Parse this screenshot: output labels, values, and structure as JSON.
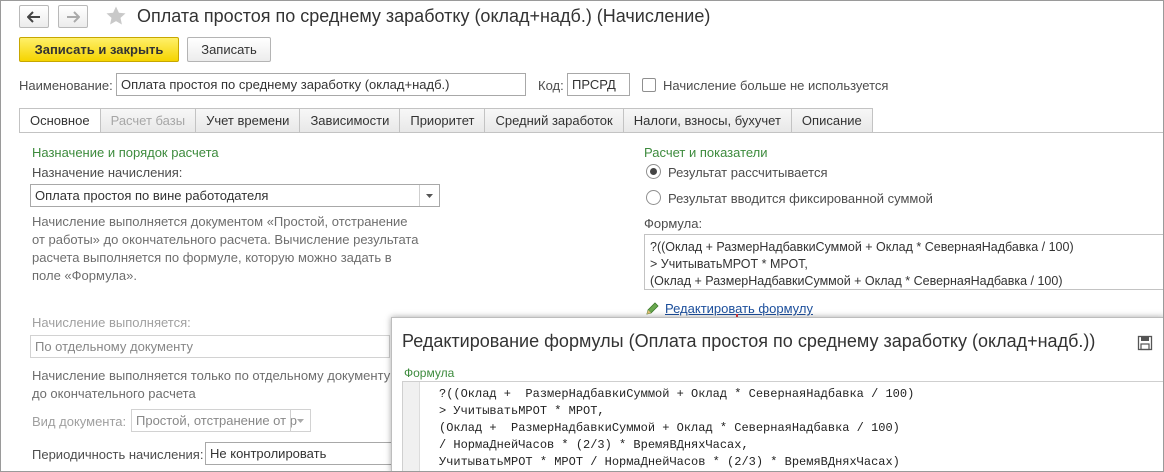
{
  "window": {
    "title": "Оплата простоя по среднему заработку (оклад+надб.) (Начисление)"
  },
  "toolbar": {
    "save_close_label": "Записать и закрыть",
    "save_label": "Записать"
  },
  "header": {
    "name_label": "Наименование:",
    "name_value": "Оплата простоя по среднему заработку (оклад+надб.)",
    "code_label": "Код:",
    "code_value": "ПРСРД",
    "unused_label": "Начисление больше не используется"
  },
  "tabs": [
    {
      "label": "Основное"
    },
    {
      "label": "Расчет базы"
    },
    {
      "label": "Учет времени"
    },
    {
      "label": "Зависимости"
    },
    {
      "label": "Приоритет"
    },
    {
      "label": "Средний заработок"
    },
    {
      "label": "Налоги, взносы, бухучет"
    },
    {
      "label": "Описание"
    }
  ],
  "left": {
    "section_title": "Назначение и порядок расчета",
    "purpose_label": "Назначение начисления:",
    "purpose_value": "Оплата простоя по вине работодателя",
    "description": "Начисление выполняется документом «Простой, отстранение от работы» до окончательного расчета. Вычисление результата расчета выполняется по формуле, которую можно задать в поле «Формула».",
    "executed_label": "Начисление выполняется:",
    "executed_value": "По отдельному документу",
    "separate_doc_text": "Начисление выполняется только по отдельному документу до окончательного расчета",
    "doc_type_label": "Вид документа:",
    "doc_type_value": "Простой, отстранение от р",
    "periodicity_label": "Периодичность начисления:",
    "periodicity_value": "Не контролировать"
  },
  "right": {
    "section_title": "Расчет и показатели",
    "radio_calculated": "Результат рассчитывается",
    "radio_fixed": "Результат вводится фиксированной суммой",
    "formula_label": "Формула:",
    "formula_lines": [
      "?((Оклад +  РазмерНадбавкиСуммой + Оклад * СевернаяНадбавка / 100)",
      "> УчитыватьМРОТ * МРОТ,",
      "(Оклад +  РазмерНадбавкиСуммой + Оклад * СевернаяНадбавка / 100)"
    ],
    "edit_formula_link": "Редактировать формулу"
  },
  "popup": {
    "title": "Редактирование формулы (Оплата простоя по среднему заработку (оклад+надб.))",
    "formula_label": "Формула",
    "code_lines": [
      "?((Оклад +  РазмерНадбавкиСуммой + Оклад * СевернаяНадбавка / 100)",
      "> УчитыватьМРОТ * МРОТ,",
      "(Оклад +  РазмерНадбавкиСуммой + Оклад * СевернаяНадбавка / 100)",
      "/ НормаДнейЧасов * (2/3) * ВремяВДняхЧасах,",
      "УчитыватьМРОТ * МРОТ / НормаДнейЧасов * (2/3) * ВремяВДняхЧасах)"
    ]
  },
  "colors": {
    "accent_yellow": "#f5d400",
    "section_green": "#3d8b3d",
    "link_blue": "#1c4f9c",
    "annotation_red": "#e0393e"
  }
}
